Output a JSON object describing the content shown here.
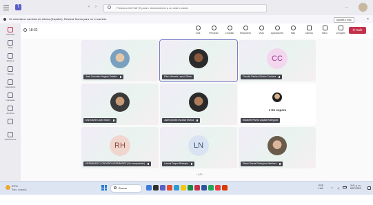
{
  "search": {
    "placeholder": "Presiona Ctrl+Alt+E para ir directamente a un chat o canal"
  },
  "window": {
    "settings_label": "Ajustes y más"
  },
  "notice": {
    "text": "Se detectaron cambios de idioma (Español). Reinicia Teams para ver el cambio."
  },
  "meeting": {
    "timer": "18:32",
    "toolbar": [
      {
        "label": "Chat",
        "icon": "chat-icon"
      },
      {
        "label": "Personas",
        "icon": "people-icon"
      },
      {
        "label": "Levantar",
        "icon": "raise-hand-icon"
      },
      {
        "label": "Reaccionar",
        "icon": "react-icon"
      },
      {
        "label": "Vista",
        "icon": "view-icon"
      },
      {
        "label": "Aplicaciones",
        "icon": "apps-icon"
      },
      {
        "label": "Más",
        "icon": "more-icon"
      },
      {
        "label": "Cámara",
        "icon": "camera-icon"
      },
      {
        "label": "Micro",
        "icon": "mic-icon"
      },
      {
        "label": "Compartir",
        "icon": "share-icon"
      }
    ],
    "leave_label": "Salir",
    "pager": "1/2",
    "colors": {
      "accent": "#6264a7",
      "leave": "#c4314b"
    }
  },
  "rail": [
    {
      "label": "Actividad",
      "icon": "bell-icon"
    },
    {
      "label": "Chat",
      "icon": "chat-icon"
    },
    {
      "label": "Equipos",
      "icon": "teams-icon"
    },
    {
      "label": "Tareas",
      "icon": "tasks-icon"
    },
    {
      "label": "Calendario",
      "icon": "calendar-icon"
    },
    {
      "label": "Llamadas",
      "icon": "calls-icon"
    },
    {
      "label": "Archivos",
      "icon": "files-icon"
    },
    {
      "label": "",
      "icon": "more-apps-icon"
    },
    {
      "label": "Aplicaciones",
      "icon": "apps-icon"
    }
  ],
  "participants": [
    {
      "name": "José Gonzalez Hagiolo Saladin",
      "type": "photo",
      "muted": true
    },
    {
      "name": "Ellen Marcela Lopez Olivos",
      "type": "photo",
      "muted": false,
      "active": true
    },
    {
      "name": "Claudia Patricia Giraldo Cardona",
      "type": "initials",
      "initials": "CC",
      "avatar_color": "#f3d7ef",
      "initials_color": "#9a3a8e",
      "muted": true
    },
    {
      "name": "Iván Daniel López Marín",
      "type": "photo",
      "muted": true
    },
    {
      "name": "Jader Andrés Escobar Muñoz",
      "type": "photo",
      "muted": true
    },
    {
      "name": "Elizabeth Rivera Zapata Rodríguez",
      "type": "waiting",
      "status": "En espera",
      "muted": false
    },
    {
      "name": "HERNÁNDEZ LONDOÑO HERNÁNDEZ (No comprobado)",
      "type": "initials",
      "initials": "RH",
      "avatar_color": "#f0d6cf",
      "initials_color": "#8a4a3a",
      "muted": true
    },
    {
      "name": "Lorena Duque Restrepo",
      "type": "initials",
      "initials": "LN",
      "avatar_color": "#d9e3f1",
      "initials_color": "#3a5578",
      "muted": true
    },
    {
      "name": "Diana Teresa Rodríguez Martínez",
      "type": "photo",
      "muted": true
    }
  ],
  "taskbar": {
    "weather_temp": "23°C",
    "weather_desc": "Parc. soleado",
    "search_label": "Buscar",
    "lang": "ESP",
    "lang_sub": "LAA",
    "time": "3:41 p. m.",
    "date": "6/07/2023"
  }
}
